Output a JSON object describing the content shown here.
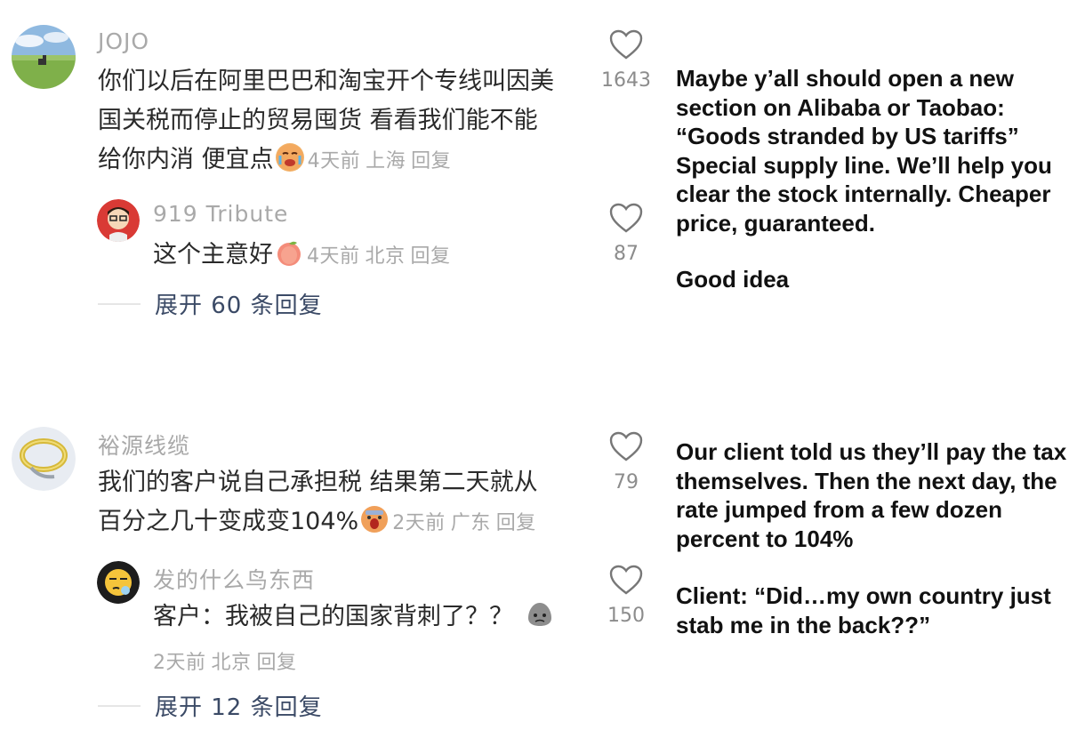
{
  "comments": [
    {
      "username": "JOJO",
      "lines": [
        "你们以后在阿里巴巴和淘宝开个专线叫因美",
        "国关税而停止的贸易囤货 看看我们能不能",
        "给你内消 便宜点"
      ],
      "emoji": "crying-face",
      "time": "4天前",
      "location": "上海",
      "reply_label": "回复",
      "likes": "1643",
      "reply": {
        "username": "919 Tribute",
        "text": "这个主意好",
        "emoji": "peach",
        "time": "4天前",
        "location": "北京",
        "reply_label": "回复",
        "likes": "87"
      },
      "expand_label": "展开 60 条回复"
    },
    {
      "username": "裕源线缆",
      "lines": [
        "我们的客户说自己承担税 结果第二天就从",
        "百分之几十变成变104%"
      ],
      "emoji": "screaming-face",
      "time": "2天前",
      "location": "广东",
      "reply_label": "回复",
      "likes": "79",
      "reply": {
        "username": "发的什么鸟东西",
        "text": "客户：我被自己的国家背刺了？？",
        "emoji": "sad-blob",
        "time": "2天前",
        "location": "北京",
        "reply_label": "回复",
        "likes": "150"
      },
      "expand_label": "展开 12 条回复"
    }
  ],
  "translations": {
    "block1": [
      "Maybe y’all should open a new",
      "section on Alibaba or Taobao:",
      "“Goods stranded by US tariffs”",
      "Special supply line. We’ll help you",
      "clear the stock internally. Cheaper",
      "price, guaranteed."
    ],
    "block1_reply": "Good idea",
    "block2": [
      "Our client told us they’ll pay the tax",
      "themselves. Then the next day, the",
      "rate jumped from a few dozen",
      "percent to 104%"
    ],
    "block2_reply": [
      "Client: “Did…my own country just",
      "stab me in the back??”"
    ]
  },
  "colors": {
    "username": "#a9a9a9",
    "expand_text": "#3b4a66",
    "like_count": "#8c8c8c"
  }
}
